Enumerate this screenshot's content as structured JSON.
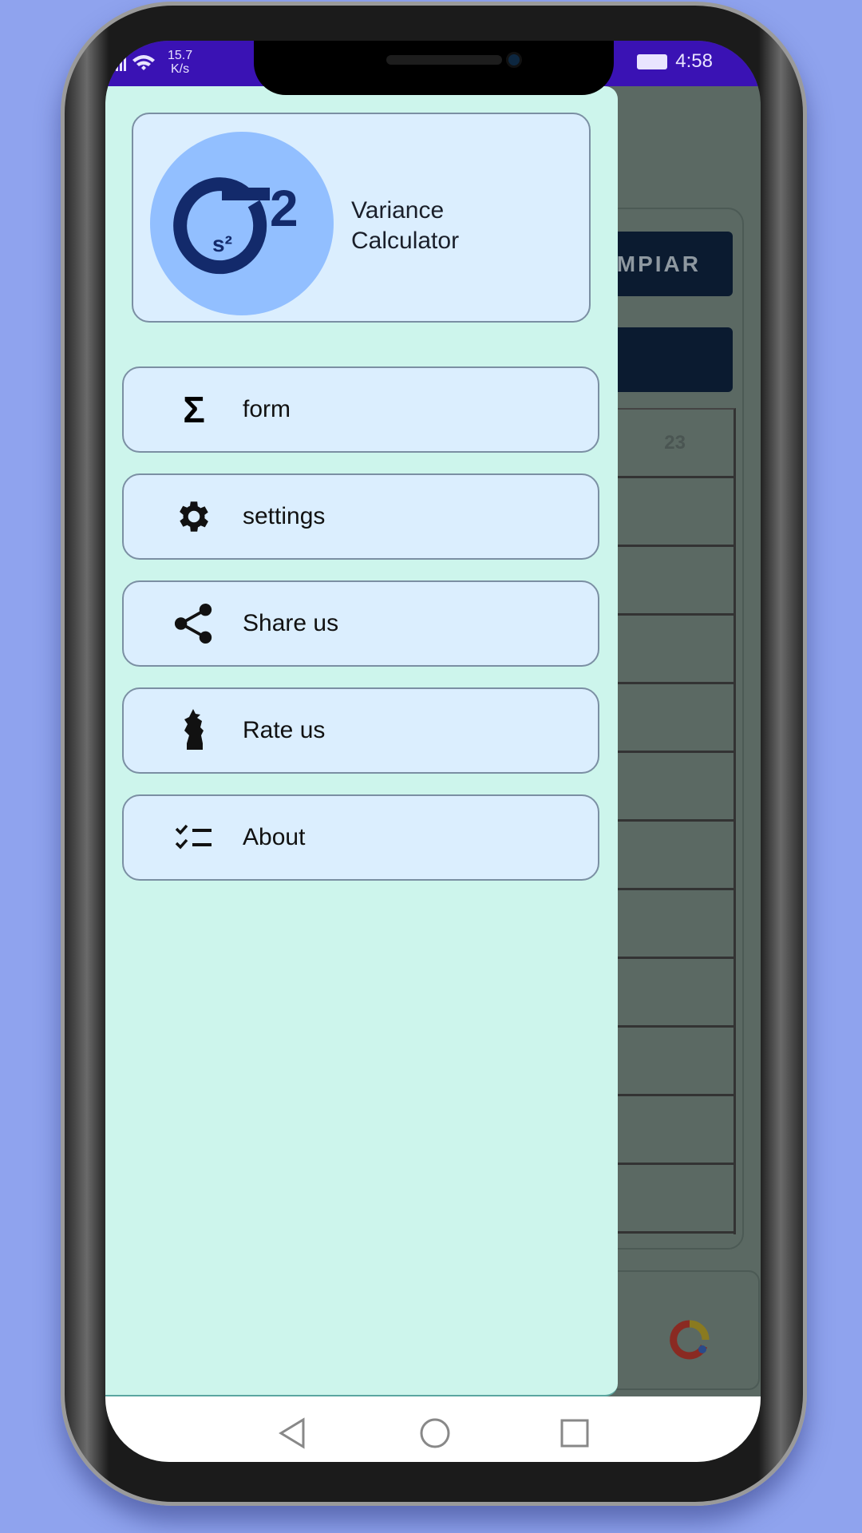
{
  "status_bar": {
    "speed_value": "15.7",
    "speed_unit": "K/s",
    "time": "4:58",
    "bar_color": "#3a12b4"
  },
  "drawer": {
    "header": {
      "logo_text": "σ²",
      "logo_inner": "s²",
      "title_line1": "Variance",
      "title_line2": "Calculator"
    },
    "items": [
      {
        "label": "form",
        "icon": "sigma-icon"
      },
      {
        "label": "settings",
        "icon": "gear-icon"
      },
      {
        "label": "Share us",
        "icon": "share-icon"
      },
      {
        "label": "Rate us",
        "icon": "rate-icon"
      },
      {
        "label": "About",
        "icon": "checklist-icon"
      }
    ],
    "background_color": "#cdf5ec"
  },
  "background_screen": {
    "clear_button": "MPIAR",
    "table_header": "23"
  },
  "nav_bar": {
    "back": "back-icon",
    "home": "home-icon",
    "recents": "recents-icon"
  }
}
